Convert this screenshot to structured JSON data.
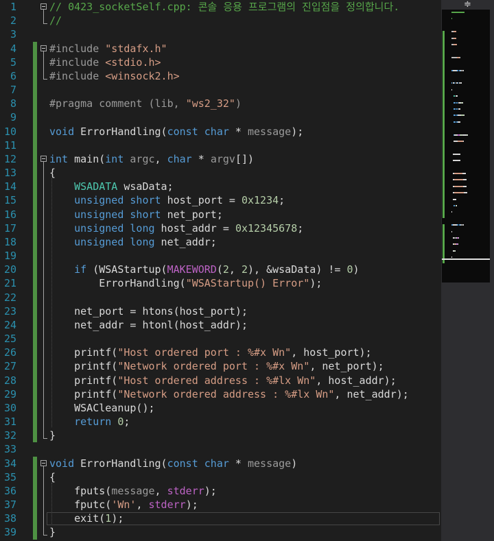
{
  "editor": {
    "line_numbers": [
      "1",
      "2",
      "3",
      "4",
      "5",
      "6",
      "7",
      "8",
      "9",
      "10",
      "11",
      "12",
      "13",
      "14",
      "15",
      "16",
      "17",
      "18",
      "19",
      "20",
      "21",
      "22",
      "23",
      "24",
      "25",
      "26",
      "27",
      "28",
      "29",
      "30",
      "31",
      "32",
      "33",
      "34",
      "35",
      "36",
      "37",
      "38",
      "39"
    ],
    "lines": [
      [
        {
          "c": "c",
          "t": "// 0423_socketSelf.cpp: 콘솔 응용 프로그램의 진입점을 정의합니다."
        }
      ],
      [
        {
          "c": "c",
          "t": "//"
        }
      ],
      [],
      [
        {
          "c": "pp",
          "t": "#include "
        },
        {
          "c": "s",
          "t": "\"stdafx.h\""
        }
      ],
      [
        {
          "c": "pp",
          "t": "#include "
        },
        {
          "c": "s",
          "t": "<stdio.h>"
        }
      ],
      [
        {
          "c": "pp",
          "t": "#include "
        },
        {
          "c": "s",
          "t": "<winsock2.h>"
        }
      ],
      [],
      [
        {
          "c": "pp",
          "t": "#pragma comment (lib, "
        },
        {
          "c": "s",
          "t": "\"ws2_32\""
        },
        {
          "c": "pp",
          "t": ")"
        }
      ],
      [],
      [
        {
          "c": "k",
          "t": "void"
        },
        {
          "c": "v",
          "t": " ErrorHandling("
        },
        {
          "c": "k",
          "t": "const"
        },
        {
          "c": "v",
          "t": " "
        },
        {
          "c": "k",
          "t": "char"
        },
        {
          "c": "v",
          "t": " * "
        },
        {
          "c": "p",
          "t": "message"
        },
        {
          "c": "v",
          "t": ");"
        }
      ],
      [],
      [
        {
          "c": "k",
          "t": "int"
        },
        {
          "c": "v",
          "t": " main("
        },
        {
          "c": "k",
          "t": "int"
        },
        {
          "c": "v",
          "t": " "
        },
        {
          "c": "p",
          "t": "argc"
        },
        {
          "c": "v",
          "t": ", "
        },
        {
          "c": "k",
          "t": "char"
        },
        {
          "c": "v",
          "t": " * "
        },
        {
          "c": "p",
          "t": "argv"
        },
        {
          "c": "v",
          "t": "[])"
        }
      ],
      [
        {
          "c": "v",
          "t": "{"
        }
      ],
      [
        {
          "c": "v",
          "t": "    "
        },
        {
          "c": "t",
          "t": "WSADATA"
        },
        {
          "c": "v",
          "t": " wsaData;"
        }
      ],
      [
        {
          "c": "v",
          "t": "    "
        },
        {
          "c": "k",
          "t": "unsigned"
        },
        {
          "c": "v",
          "t": " "
        },
        {
          "c": "k",
          "t": "short"
        },
        {
          "c": "v",
          "t": " host_port = "
        },
        {
          "c": "n",
          "t": "0x1234"
        },
        {
          "c": "v",
          "t": ";"
        }
      ],
      [
        {
          "c": "v",
          "t": "    "
        },
        {
          "c": "k",
          "t": "unsigned"
        },
        {
          "c": "v",
          "t": " "
        },
        {
          "c": "k",
          "t": "short"
        },
        {
          "c": "v",
          "t": " net_port;"
        }
      ],
      [
        {
          "c": "v",
          "t": "    "
        },
        {
          "c": "k",
          "t": "unsigned"
        },
        {
          "c": "v",
          "t": " "
        },
        {
          "c": "k",
          "t": "long"
        },
        {
          "c": "v",
          "t": " host_addr = "
        },
        {
          "c": "n",
          "t": "0x12345678"
        },
        {
          "c": "v",
          "t": ";"
        }
      ],
      [
        {
          "c": "v",
          "t": "    "
        },
        {
          "c": "k",
          "t": "unsigned"
        },
        {
          "c": "v",
          "t": " "
        },
        {
          "c": "k",
          "t": "long"
        },
        {
          "c": "v",
          "t": " net_addr;"
        }
      ],
      [],
      [
        {
          "c": "v",
          "t": "    "
        },
        {
          "c": "k",
          "t": "if"
        },
        {
          "c": "v",
          "t": " (WSAStartup("
        },
        {
          "c": "m",
          "t": "MAKEWORD"
        },
        {
          "c": "v",
          "t": "("
        },
        {
          "c": "n",
          "t": "2"
        },
        {
          "c": "v",
          "t": ", "
        },
        {
          "c": "n",
          "t": "2"
        },
        {
          "c": "v",
          "t": "), &wsaData) != "
        },
        {
          "c": "n",
          "t": "0"
        },
        {
          "c": "v",
          "t": ")"
        }
      ],
      [
        {
          "c": "v",
          "t": "        ErrorHandling("
        },
        {
          "c": "s",
          "t": "\"WSAStartup() Error\""
        },
        {
          "c": "v",
          "t": ");"
        }
      ],
      [],
      [
        {
          "c": "v",
          "t": "    net_port = htons(host_port);"
        }
      ],
      [
        {
          "c": "v",
          "t": "    net_addr = htonl(host_addr);"
        }
      ],
      [],
      [
        {
          "c": "v",
          "t": "    printf("
        },
        {
          "c": "s",
          "t": "\"Host ordered port : %#x Wn\""
        },
        {
          "c": "v",
          "t": ", host_port);"
        }
      ],
      [
        {
          "c": "v",
          "t": "    printf("
        },
        {
          "c": "s",
          "t": "\"Network ordered port : %#x Wn\""
        },
        {
          "c": "v",
          "t": ", net_port);"
        }
      ],
      [
        {
          "c": "v",
          "t": "    printf("
        },
        {
          "c": "s",
          "t": "\"Host ordered address : %#lx Wn\""
        },
        {
          "c": "v",
          "t": ", host_addr);"
        }
      ],
      [
        {
          "c": "v",
          "t": "    printf("
        },
        {
          "c": "s",
          "t": "\"Network ordered address : %#lx Wn\""
        },
        {
          "c": "v",
          "t": ", net_addr);"
        }
      ],
      [
        {
          "c": "v",
          "t": "    WSACleanup();"
        }
      ],
      [
        {
          "c": "v",
          "t": "    "
        },
        {
          "c": "k",
          "t": "return"
        },
        {
          "c": "v",
          "t": " "
        },
        {
          "c": "n",
          "t": "0"
        },
        {
          "c": "v",
          "t": ";"
        }
      ],
      [
        {
          "c": "v",
          "t": "}"
        }
      ],
      [],
      [
        {
          "c": "k",
          "t": "void"
        },
        {
          "c": "v",
          "t": " ErrorHandling("
        },
        {
          "c": "k",
          "t": "const"
        },
        {
          "c": "v",
          "t": " "
        },
        {
          "c": "k",
          "t": "char"
        },
        {
          "c": "v",
          "t": " * "
        },
        {
          "c": "p",
          "t": "message"
        },
        {
          "c": "v",
          "t": ")"
        }
      ],
      [
        {
          "c": "v",
          "t": "{"
        }
      ],
      [
        {
          "c": "v",
          "t": "    fputs("
        },
        {
          "c": "p",
          "t": "message"
        },
        {
          "c": "v",
          "t": ", "
        },
        {
          "c": "m",
          "t": "stderr"
        },
        {
          "c": "v",
          "t": ");"
        }
      ],
      [
        {
          "c": "v",
          "t": "    fputc("
        },
        {
          "c": "s",
          "t": "'Wn'"
        },
        {
          "c": "v",
          "t": ", "
        },
        {
          "c": "m",
          "t": "stderr"
        },
        {
          "c": "v",
          "t": ");"
        }
      ],
      [
        {
          "c": "v",
          "t": "    exit("
        },
        {
          "c": "n",
          "t": "1"
        },
        {
          "c": "v",
          "t": ");"
        }
      ],
      [
        {
          "c": "v",
          "t": "}"
        }
      ]
    ],
    "current_line": 38
  },
  "minimap": {
    "split_handle_glyph": "≑"
  },
  "colors": {
    "background": "#1e1e1e",
    "line_number": "#2b91af",
    "comment": "#57a64a",
    "keyword": "#569cd6",
    "string": "#d69d85",
    "type": "#4ec9b0",
    "macro": "#bd63c5",
    "preprocessor": "#9b9b9b",
    "change_marker": "#57a64a"
  }
}
